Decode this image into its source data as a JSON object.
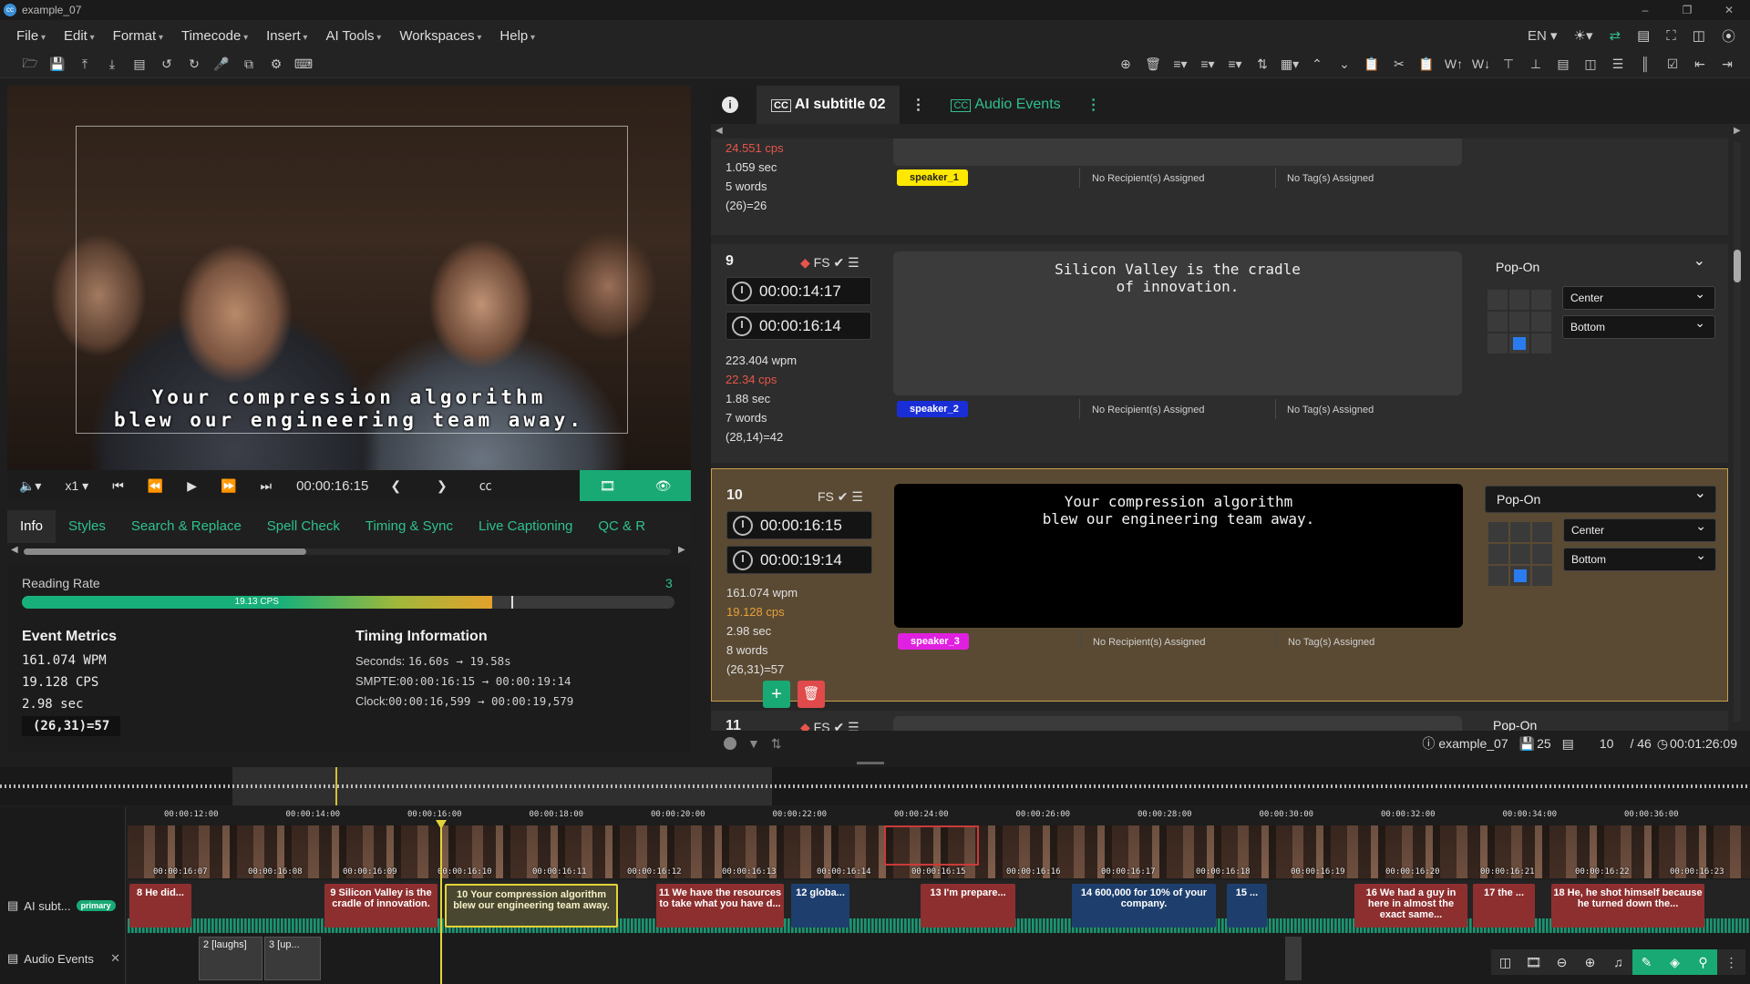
{
  "window": {
    "title": "example_07",
    "controls": [
      "–",
      "❐",
      "✕"
    ]
  },
  "menu": [
    "File",
    "Edit",
    "Format",
    "Timecode",
    "Insert",
    "AI Tools",
    "Workspaces",
    "Help"
  ],
  "menu_right": {
    "lang": "EN"
  },
  "video": {
    "caption_line1": "Your compression algorithm",
    "caption_line2": "blew our engineering team away."
  },
  "transport": {
    "speed": "x1",
    "timecode": "00:00:16:15"
  },
  "info_tabs": [
    "Info",
    "Styles",
    "Search & Replace",
    "Spell Check",
    "Timing & Sync",
    "Live Captioning",
    "QC & R"
  ],
  "reading_rate": {
    "label": "Reading Rate",
    "count": "3",
    "bar_text": "19.13 CPS",
    "fill_fraction": 0.72,
    "marker_fraction": 0.75
  },
  "event_metrics": {
    "title": "Event Metrics",
    "wpm": "161.074 WPM",
    "cps": "19.128 CPS",
    "sec": "2.98 sec",
    "chars": "(26,31)=57"
  },
  "timing_info": {
    "title": "Timing Information",
    "seconds_label": "Seconds:",
    "seconds": "16.60s → 19.58s",
    "smpte_label": "SMPTE:",
    "smpte": "00:00:16:15 → 00:00:19:14",
    "clock_label": "Clock:",
    "clock": "00:00:16,599 → 00:00:19,579"
  },
  "right_tabs": {
    "info": "i",
    "subtitle_tab": "AI subtitle 02",
    "audio_tab": "Audio Events"
  },
  "prev_event": {
    "cps": "24.551 cps",
    "sec": "1.059 sec",
    "words": "5 words",
    "chars": "(26)=26",
    "speaker": "speaker_1",
    "recipients": "No Recipient(s) Assigned",
    "tags": "No Tag(s) Assigned"
  },
  "events": [
    {
      "num": "9",
      "flags": "FS",
      "start": "00:00:14:17",
      "end": "00:00:16:14",
      "wpm": "223.404 wpm",
      "cps": "22.34 cps",
      "sec": "1.88 sec",
      "words": "7 words",
      "chars": "(28,14)=42",
      "text": "Silicon Valley is the cradle\nof innovation.",
      "speaker": "speaker_2",
      "recipients": "No Recipient(s) Assigned",
      "tags": "No Tag(s) Assigned",
      "mode": "Pop-On",
      "h_align": "Center",
      "v_align": "Bottom"
    },
    {
      "num": "10",
      "flags": "FS",
      "start": "00:00:16:15",
      "end": "00:00:19:14",
      "wpm": "161.074 wpm",
      "cps": "19.128 cps",
      "sec": "2.98 sec",
      "words": "8 words",
      "chars": "(26,31)=57",
      "text": "Your compression algorithm\nblew our engineering team away.",
      "speaker": "speaker_3",
      "recipients": "No Recipient(s) Assigned",
      "tags": "No Tag(s) Assigned",
      "mode": "Pop-On",
      "h_align": "Center",
      "v_align": "Bottom"
    }
  ],
  "next_event": {
    "num": "11",
    "flags": "FS",
    "mode": "Pop-On"
  },
  "status_bar": {
    "file": "example_07",
    "count": "25",
    "current": "10",
    "total": "/ 46",
    "duration": "00:01:26:09"
  },
  "timeline": {
    "ruler": [
      "00:00:12:00",
      "00:00:14:00",
      "00:00:16:00",
      "00:00:18:00",
      "00:00:20:00",
      "00:00:22:00",
      "00:00:24:00",
      "00:00:26:00",
      "00:00:28:00",
      "00:00:30:00",
      "00:00:32:00",
      "00:00:34:00",
      "00:00:36:00"
    ],
    "frame_ticks": [
      "00:00:16:07",
      "00:00:16:08",
      "00:00:16:09",
      "00:00:16:10",
      "00:00:16:11",
      "00:00:16:12",
      "00:00:16:13",
      "00:00:16:14",
      "00:00:16:15",
      "00:00:16:16",
      "00:00:16:17",
      "00:00:16:18",
      "00:00:16:19",
      "00:00:16:20",
      "00:00:16:21",
      "00:00:16:22",
      "00:00:16:23"
    ],
    "track_sub": "AI subt...",
    "track_sub_badge": "primary",
    "track_audio": "Audio Events",
    "segments": [
      {
        "text": "8 He did...",
        "kind": "red"
      },
      {
        "text": "9   Silicon Valley is the cradle of innovation.",
        "kind": "red"
      },
      {
        "text": "10   Your compression algorithm blew our engineering team away.",
        "kind": "sel"
      },
      {
        "text": "11        We have the resources to take what you have d...",
        "kind": "red"
      },
      {
        "text": "12  globa...",
        "kind": "blue"
      },
      {
        "text": "13  I'm prepare...",
        "kind": "red"
      },
      {
        "text": "14  600,000 for 10% of your company.",
        "kind": "blue"
      },
      {
        "text": "15 ...",
        "kind": "blue"
      },
      {
        "text": "16  We had a guy in here in almost the exact same...",
        "kind": "red"
      },
      {
        "text": "17  the ...",
        "kind": "red"
      },
      {
        "text": "18      He, he shot himself because he turned down the...",
        "kind": "red"
      }
    ],
    "audio_segments": [
      "2  [laughs]",
      "3  [up..."
    ]
  }
}
